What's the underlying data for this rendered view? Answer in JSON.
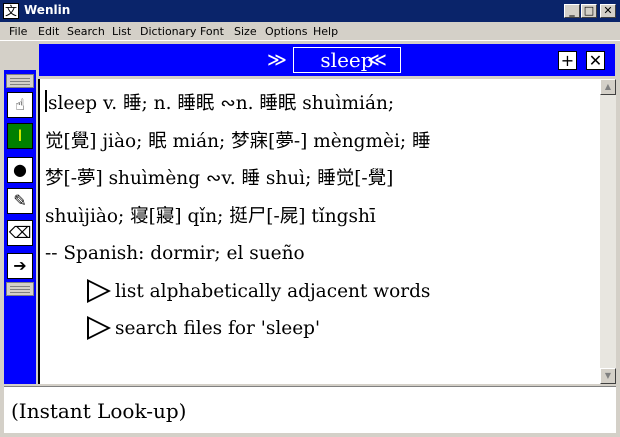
{
  "window": {
    "title": "Wenlin",
    "app_icon": "文",
    "minimize_label": "_",
    "maximize_label": "□",
    "close_label": "✕"
  },
  "menu": [
    "File",
    "Edit",
    "Search",
    "List",
    "Dictionary",
    "Font",
    "Size",
    "Options",
    "Help"
  ],
  "lookup": {
    "word": "sleep",
    "forward_arrows": "≫",
    "back_arrows": "≪",
    "add_label": "+",
    "close_label": "✕"
  },
  "toolbar": {
    "icons": [
      "hand-icon",
      "text-cursor-icon",
      "dot-icon",
      "pen-icon",
      "eraser-icon",
      "arrow-icon"
    ],
    "glyphs": [
      "☝",
      "I",
      "●",
      "✎",
      "⌫",
      "➔"
    ]
  },
  "entry": {
    "lines": [
      "sleep v. 睡; n. 睡眠 ∾n. 睡眠 shuìmián;",
      "觉[覺] jiào; 眠 mián; 梦寐[夢-] mèngmèi; 睡",
      "梦[-夢] shuìmèng ∾v. 睡 shuì; 睡觉[-覺]",
      "shuìjiào; 寝[寢] qǐn; 挺尸[-屍] tǐngshī",
      "-- Spanish: dormir; el sueño"
    ],
    "links": [
      "list alphabetically adjacent words",
      "search files for 'sleep'"
    ]
  },
  "scrollbar": {
    "up_label": "▲",
    "down_label": "▼"
  },
  "status": {
    "text": "(Instant Look-up)"
  }
}
